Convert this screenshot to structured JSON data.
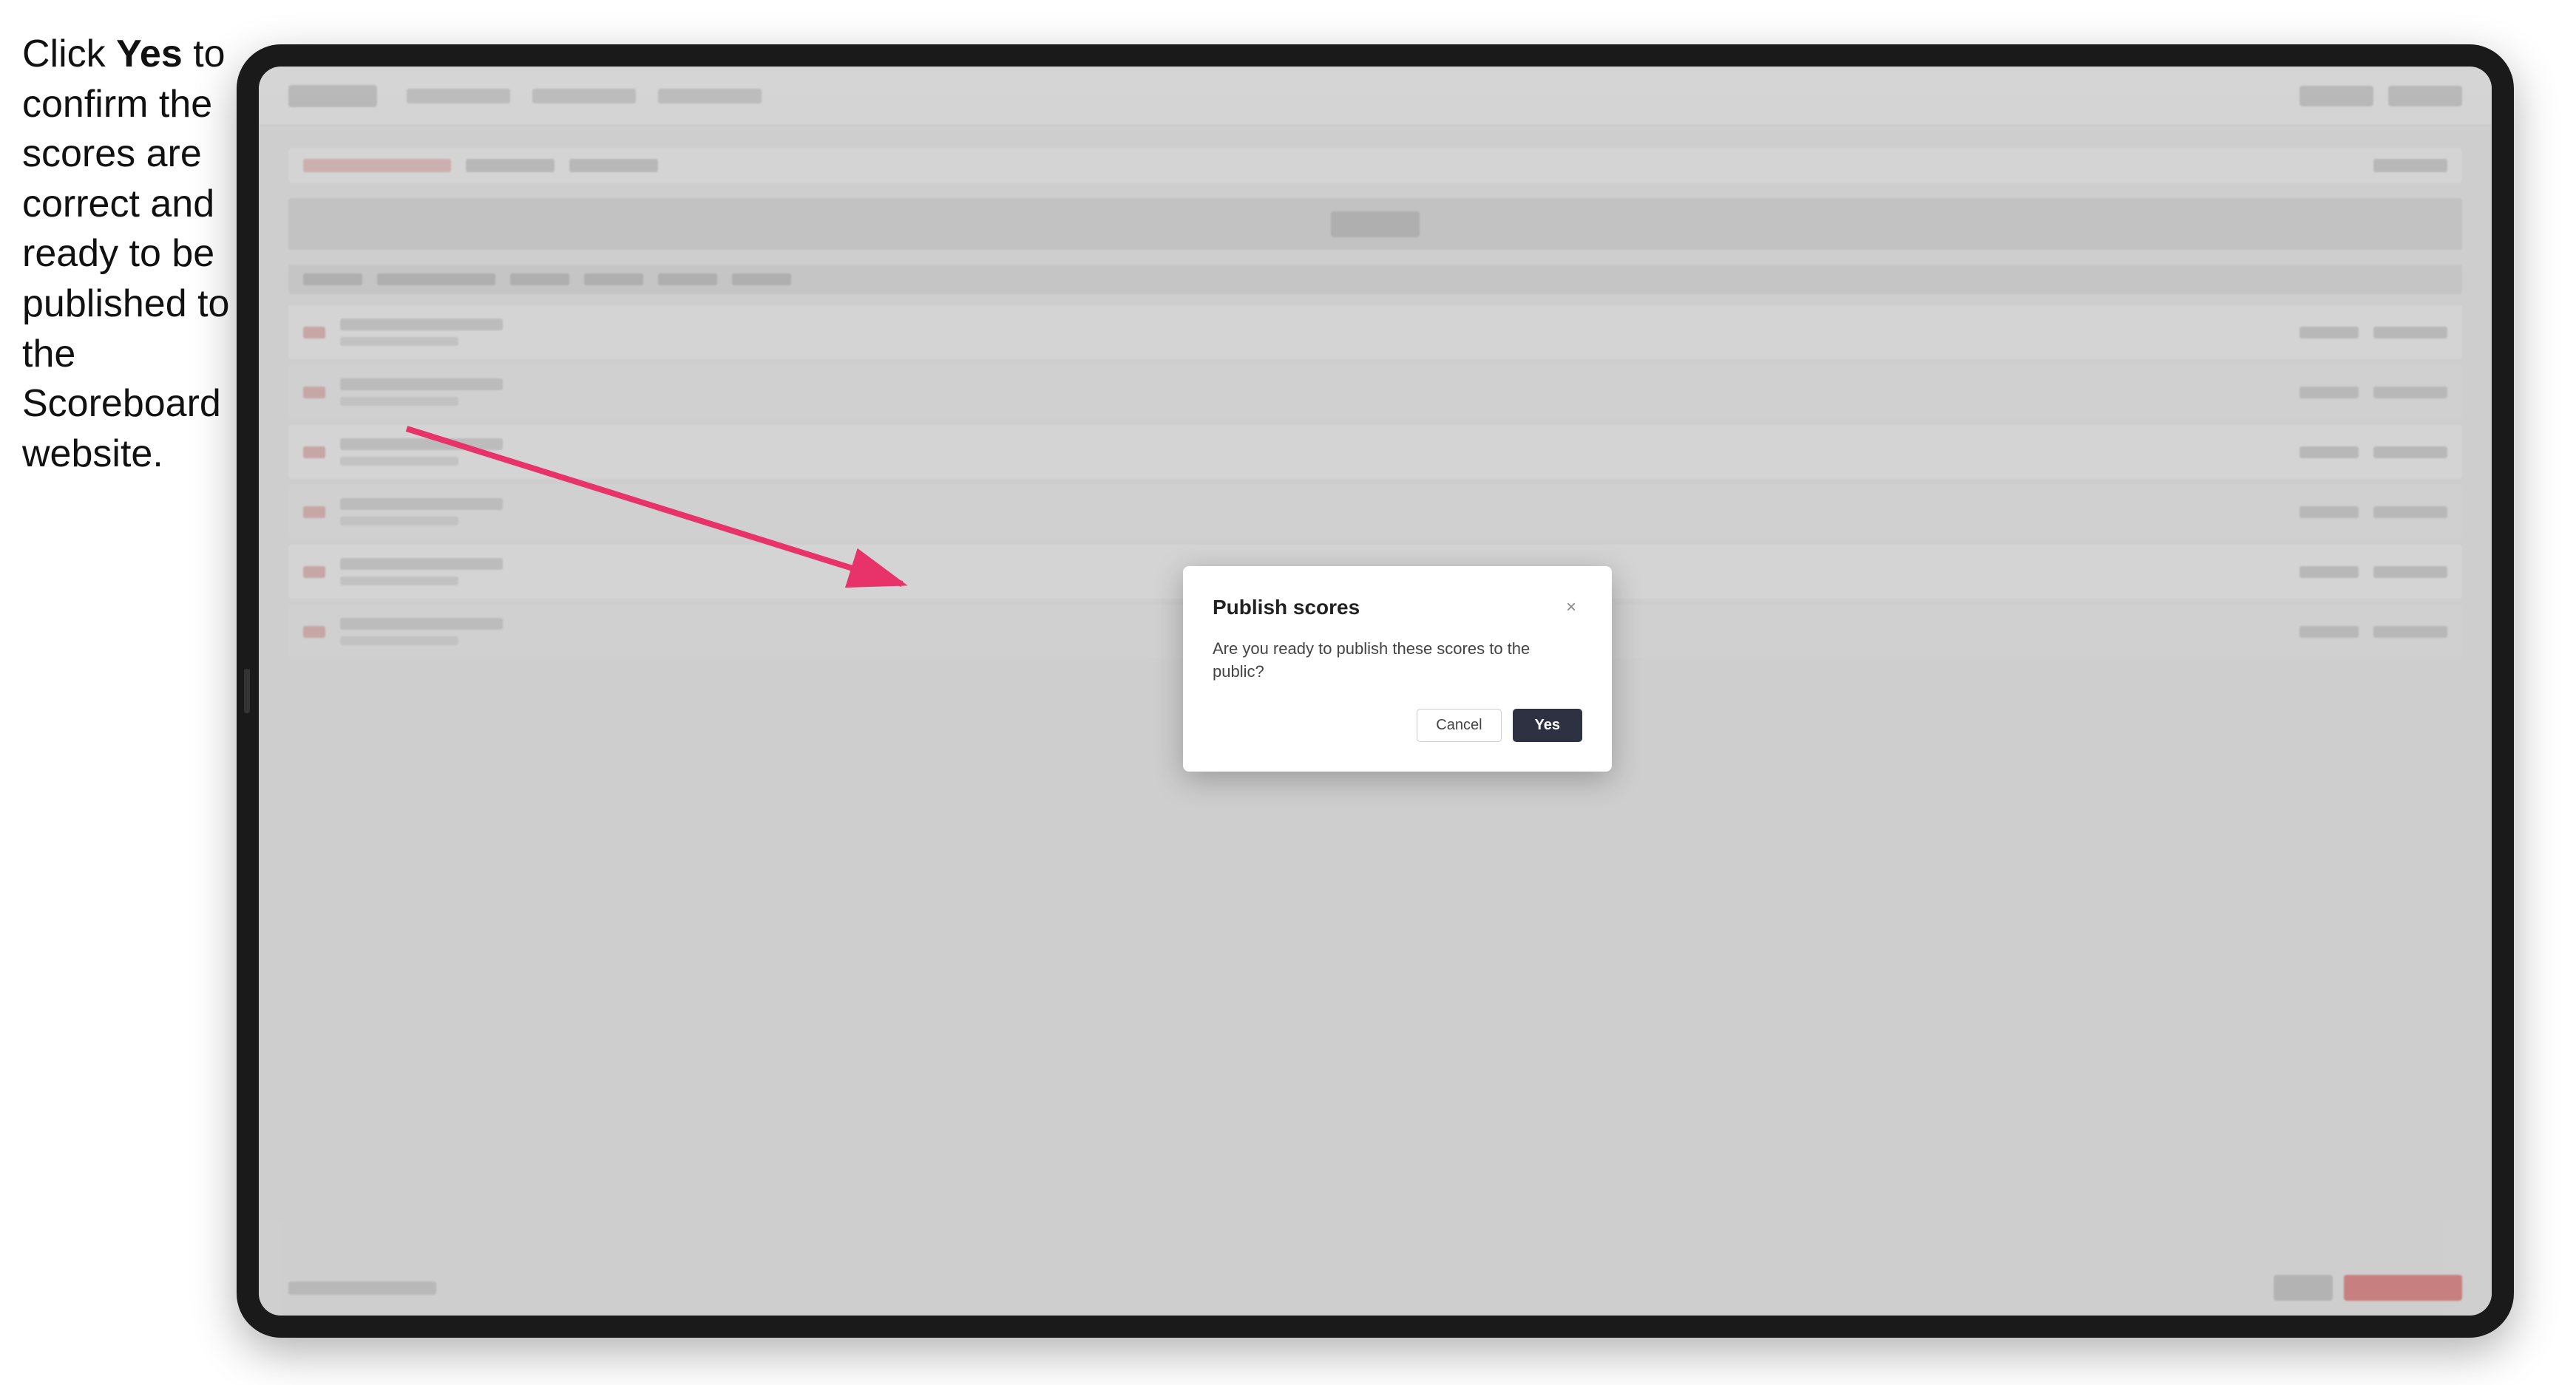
{
  "instruction": {
    "text_part1": "Click ",
    "bold": "Yes",
    "text_part2": " to confirm the scores are correct and ready to be published to the Scoreboard website."
  },
  "modal": {
    "title": "Publish scores",
    "body": "Are you ready to publish these scores to the public?",
    "cancel_label": "Cancel",
    "yes_label": "Yes",
    "close_icon": "×"
  },
  "colors": {
    "arrow": "#e8336a",
    "yes_button_bg": "#2d3142",
    "yes_button_text": "#ffffff",
    "cancel_border": "#cccccc"
  }
}
